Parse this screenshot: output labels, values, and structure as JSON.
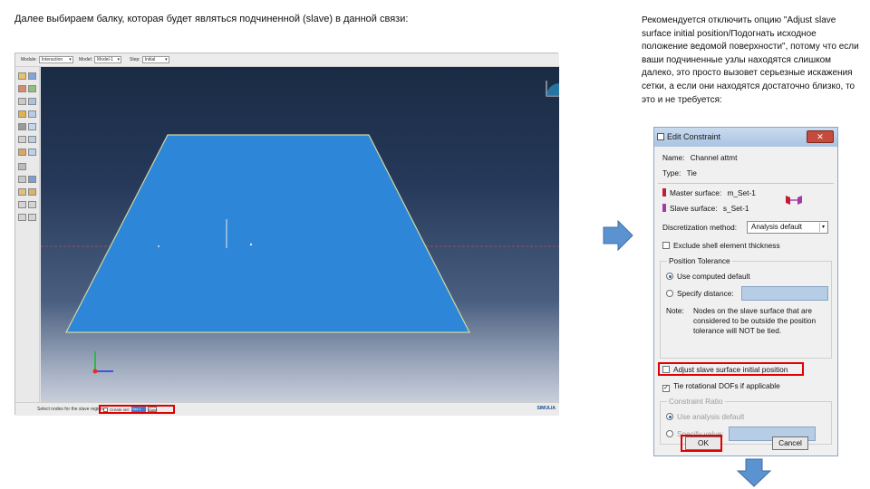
{
  "slide": {
    "caption_left": "Далее выбираем балку, которая будет являться подчиненной (slave) в данной связи:",
    "caption_right": "Рекомендуется отключить опцию \"Adjust slave surface initial position/Подогнать исходное положение ведомой поверхности\", потому что если ваши подчиненные узлы находятся слишком далеко, это просто вызовет серьезные искажения сетки, а если они находятся достаточно близко, то это и не требуется:"
  },
  "abaqus": {
    "context_bar": {
      "module_label": "Module:",
      "module_value": "Interaction",
      "model_label": "Model:",
      "model_value": "Model-1",
      "step_label": "Step:",
      "step_value": "Initial"
    },
    "status": {
      "prompt": "Select nodes for the slave region",
      "checkbox_label": "Create set:",
      "set_field": "Set-1",
      "done_button": "Done"
    },
    "logo": "SIMULIA",
    "colors": {
      "plate": "#2e86d8",
      "viewport_top": "#1a2b44",
      "viewport_bottom": "#c8ceda"
    }
  },
  "dialog": {
    "title": "Edit Constraint",
    "close_label": "✕",
    "name_label": "Name:",
    "name_value": "Channel attmt",
    "type_label": "Type:",
    "type_value": "Tie",
    "master_label": "Master surface:",
    "master_value": "m_Set-1",
    "slave_label": "Slave surface:",
    "slave_value": "s_Set-1",
    "discretization_label": "Discretization method:",
    "discretization_value": "Analysis default",
    "exclude_shell": "Exclude shell element thickness",
    "position_tolerance_label": "Position Tolerance",
    "use_computed_default": "Use computed default",
    "specify_distance": "Specify distance:",
    "note_label": "Note:",
    "note_text": "Nodes on the slave surface that are considered to be outside the position tolerance will NOT be tied.",
    "adjust_slave": "Adjust slave surface initial position",
    "tie_rotational": "Tie rotational DOFs if applicable",
    "constraint_ratio_label": "Constraint Ratio",
    "use_analysis_default": "Use analysis default",
    "specify_value": "Specify value:",
    "ok_button": "OK",
    "cancel_button": "Cancel",
    "colors": {
      "highlight": "#e00000",
      "master_icon": "#c21a3a",
      "slave_icon": "#a43aa8"
    }
  }
}
